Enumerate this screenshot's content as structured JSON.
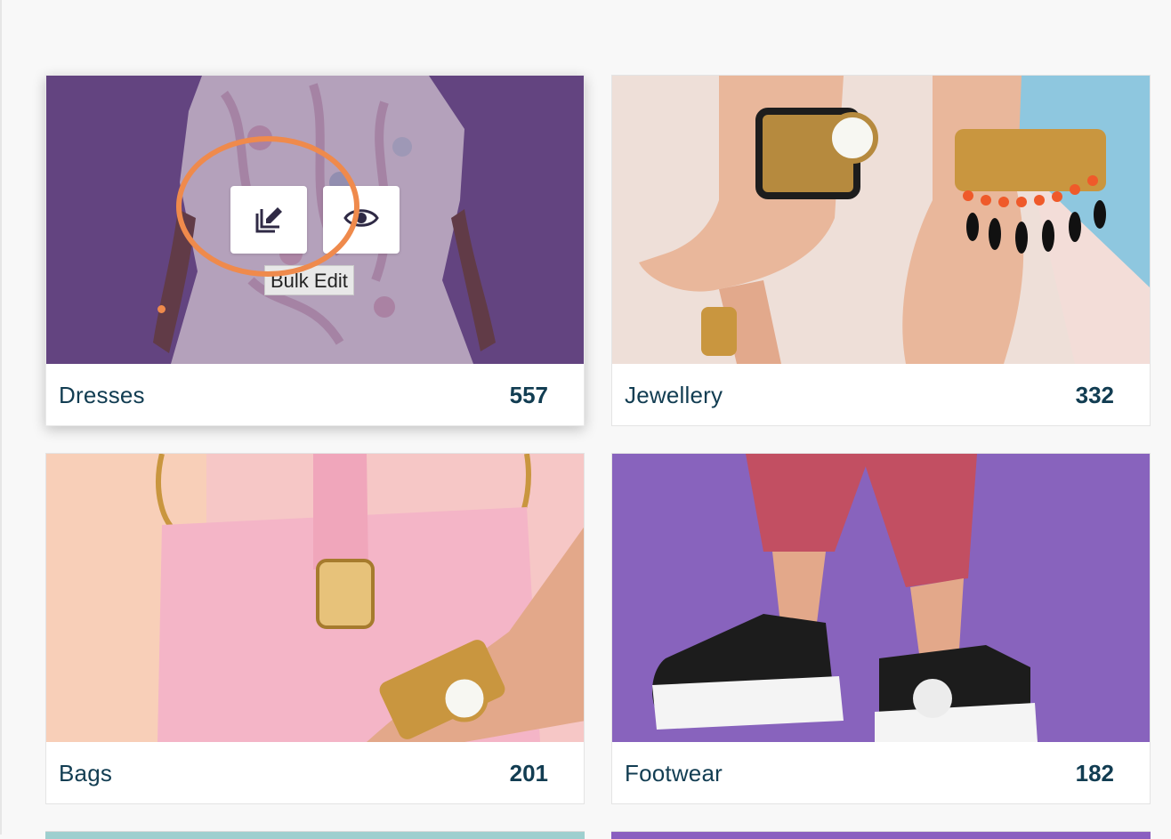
{
  "categories": [
    {
      "name": "Dresses",
      "count": "557"
    },
    {
      "name": "Jewellery",
      "count": "332"
    },
    {
      "name": "Bags",
      "count": "201"
    },
    {
      "name": "Footwear",
      "count": "182"
    }
  ],
  "hover_actions": {
    "tooltip": "Bulk Edit",
    "edit_icon": "bulk-edit-icon",
    "view_icon": "eye-icon"
  },
  "colors": {
    "text": "#123d52",
    "highlight": "#ef8a4c",
    "dresses_bg": "#6a4f86",
    "jewellery_bg": "#eedfd8",
    "bags_bg": "#f6c7c6",
    "footwear_bg": "#8863bd"
  }
}
